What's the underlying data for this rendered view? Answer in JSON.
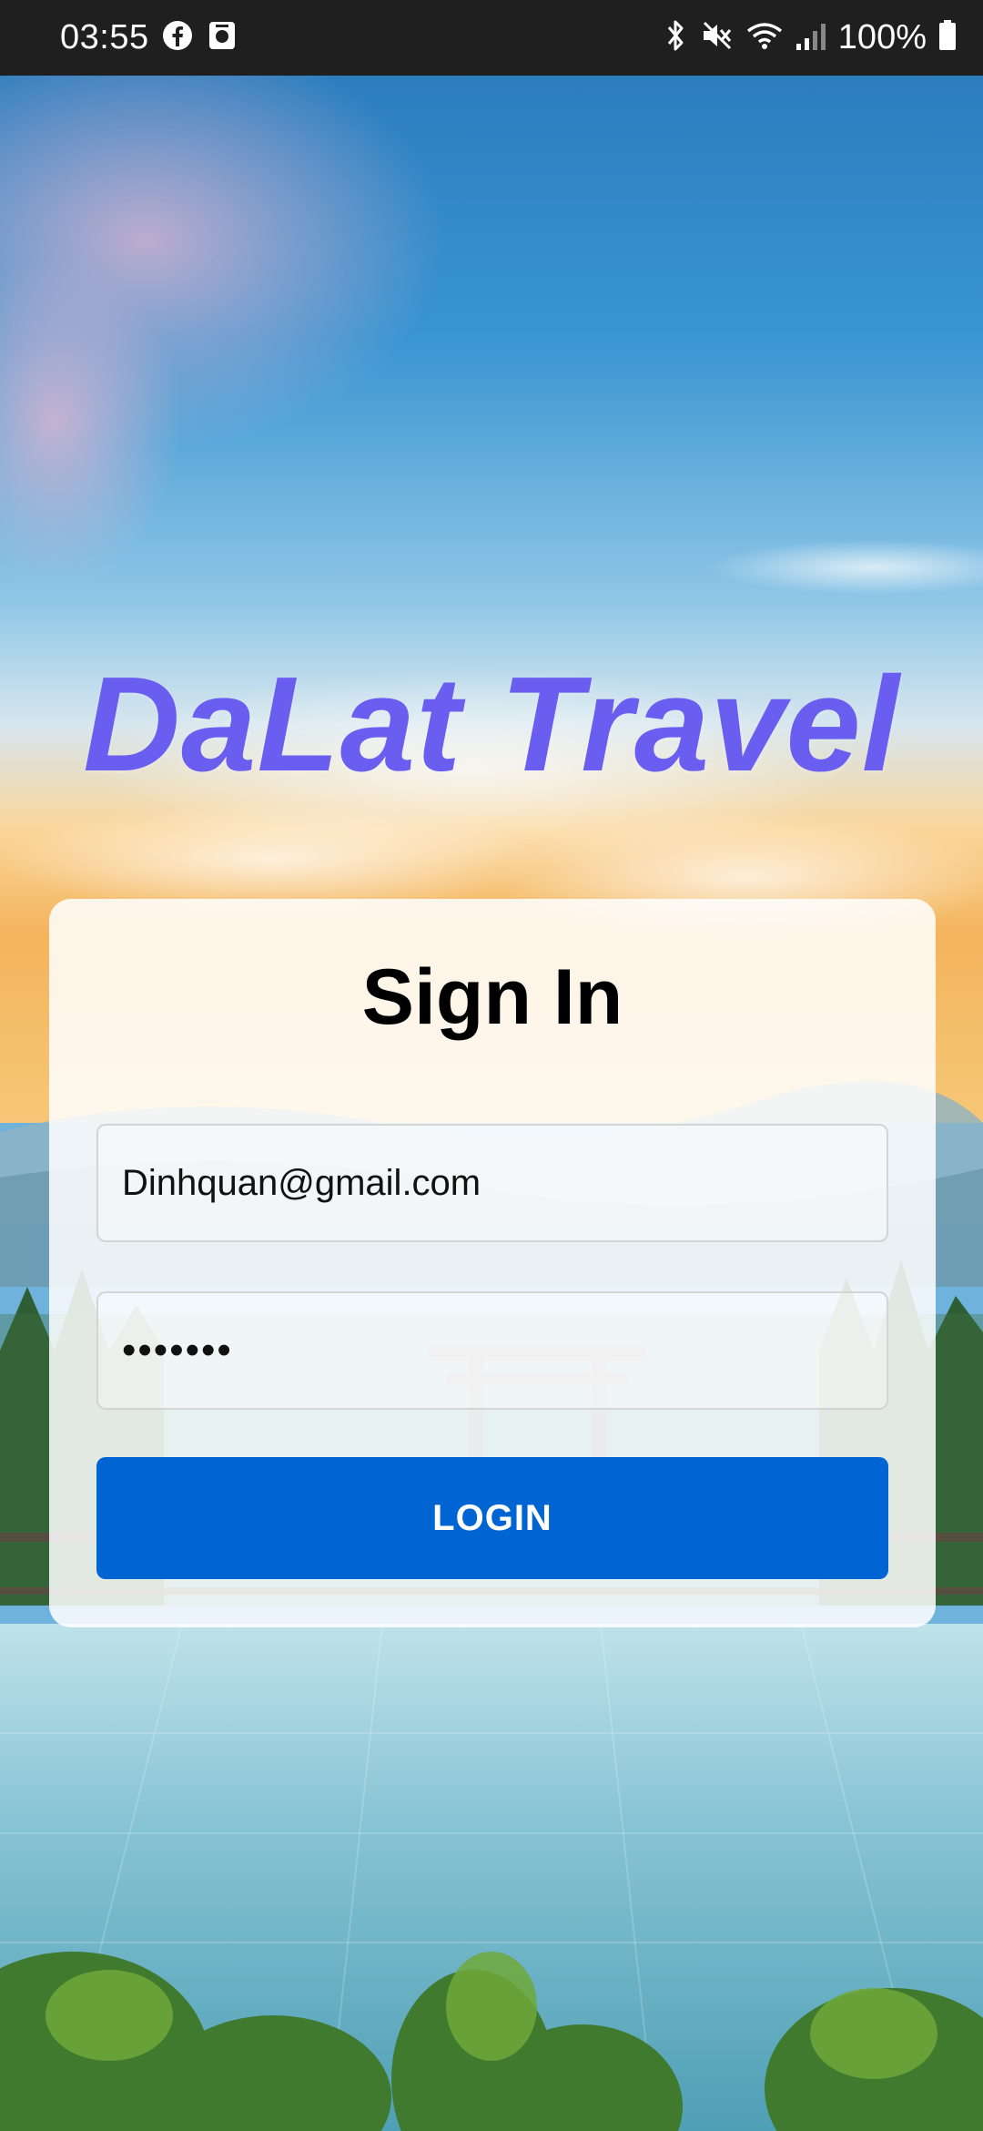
{
  "status_bar": {
    "time": "03:55",
    "battery": "100%",
    "left_icons": [
      "facebook-icon",
      "notification-icon"
    ],
    "right_icons": [
      "bluetooth-icon",
      "mute-icon",
      "wifi-icon",
      "signal-icon",
      "battery-icon"
    ]
  },
  "app": {
    "title": "DaLat Travel"
  },
  "login_card": {
    "heading": "Sign In",
    "email_value": "Dinhquan@gmail.com",
    "password_value": "•••••••",
    "login_label": "LOGIN"
  },
  "colors": {
    "title": "#6a5ef0",
    "button": "#0064d2",
    "status_bar": "#1f1f1f"
  }
}
